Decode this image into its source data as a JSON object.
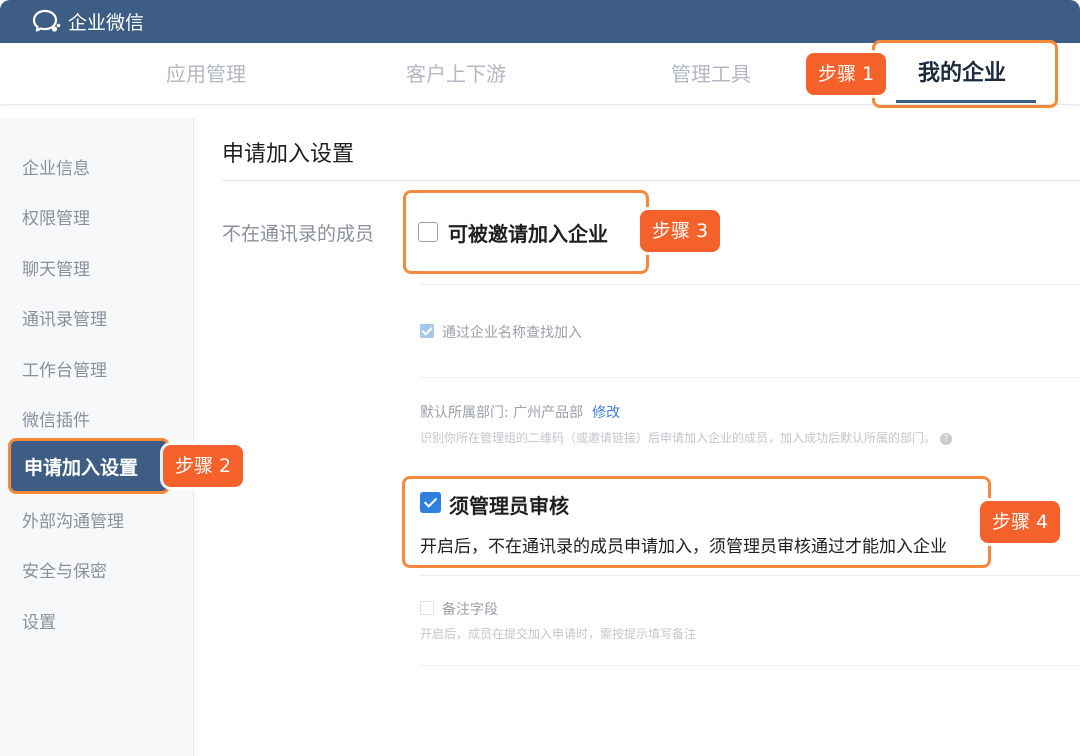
{
  "app": {
    "title": "企业微信"
  },
  "tabs": [
    {
      "label": "应用管理"
    },
    {
      "label": "客户上下游"
    },
    {
      "label": "管理工具"
    },
    {
      "label": "我的企业",
      "active": true
    }
  ],
  "steps": [
    "步骤 1",
    "步骤 2",
    "步骤 3",
    "步骤 4"
  ],
  "sidebar": {
    "items": [
      {
        "label": "企业信息"
      },
      {
        "label": "权限管理"
      },
      {
        "label": "聊天管理"
      },
      {
        "label": "通讯录管理"
      },
      {
        "label": "工作台管理"
      },
      {
        "label": "微信插件"
      },
      {
        "label": "申请加入设置",
        "active": true
      },
      {
        "label": "外部沟通管理"
      },
      {
        "label": "安全与保密"
      },
      {
        "label": "设置"
      }
    ]
  },
  "main": {
    "title": "申请加入设置",
    "row_label": "不在通讯录的成员",
    "options": {
      "invite": {
        "label": "可被邀请加入企业",
        "checked": false
      },
      "search": {
        "label": "通过企业名称查找加入",
        "checked": true
      },
      "default_dept": {
        "label": "默认所属部门: 广州产品部",
        "edit": "修改",
        "hint": "识别你所在管理组的二维码（或邀请链接）后申请加入企业的成员，加入成功后默认所属的部门。",
        "help": "?"
      },
      "admin_review": {
        "label": "须管理员审核",
        "checked": true,
        "desc": "开启后，不在通讯录的成员申请加入，须管理员审核通过才能加入企业"
      },
      "remark": {
        "label": "备注字段",
        "checked": false,
        "hint": "开启后，成员在提交加入申请时，需按提示填写备注"
      }
    }
  },
  "colors": {
    "brand": "#3d5d85",
    "highlight": "#f58a3a",
    "step_badge": "#f5612a",
    "checkbox_blue": "#2d7fe0"
  }
}
